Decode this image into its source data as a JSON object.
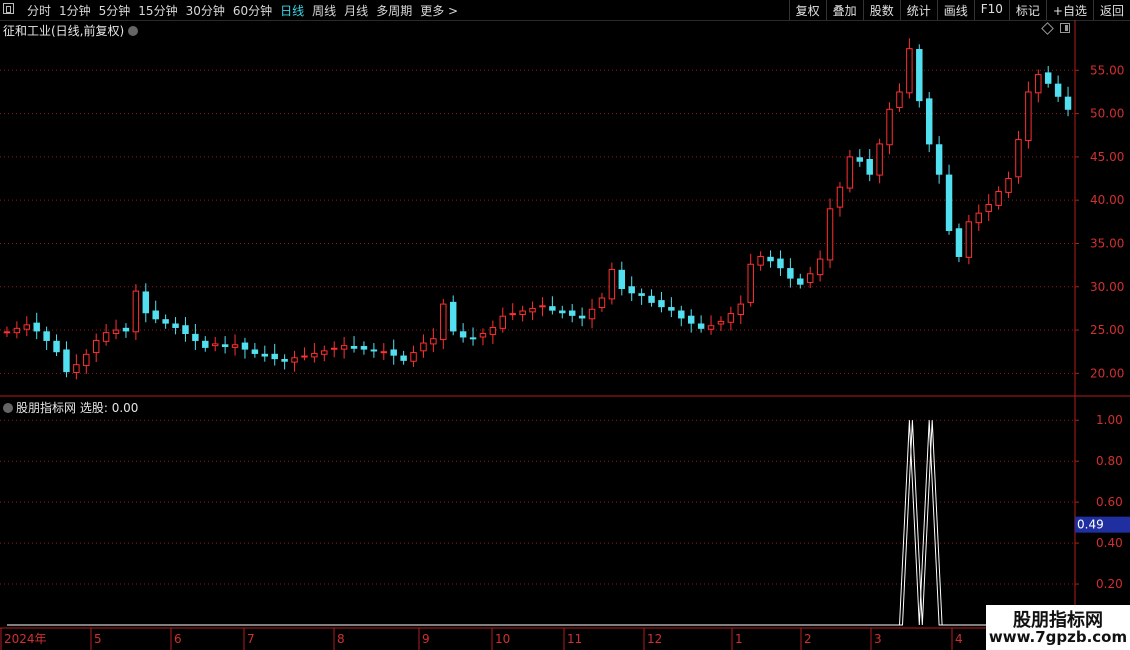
{
  "toolbar": {
    "periods": [
      "分时",
      "1分钟",
      "5分钟",
      "15分钟",
      "30分钟",
      "60分钟",
      "日线",
      "周线",
      "月线",
      "多周期",
      "更多 >"
    ],
    "active_period": "日线",
    "right_buttons": [
      "复权",
      "叠加",
      "股数",
      "统计",
      "画线",
      "F10",
      "标记",
      "+自选",
      "返回"
    ]
  },
  "main_chart": {
    "title": "征和工业(日线,前复权)",
    "y_ticks": [
      "55.00",
      "50.00",
      "45.00",
      "40.00",
      "35.00",
      "30.00",
      "25.00",
      "20.00"
    ]
  },
  "sub_chart": {
    "title": "股朋指标网",
    "indicator_label": "选股:",
    "indicator_value": "0.00",
    "y_ticks": [
      "1.00",
      "0.80",
      "0.60",
      "0.40",
      "0.20"
    ],
    "cursor_value": "0.49"
  },
  "x_axis": {
    "labels": [
      "2024年",
      "5",
      "6",
      "7",
      "8",
      "9",
      "10",
      "11",
      "12",
      "1",
      "2",
      "3",
      "4"
    ]
  },
  "watermark": {
    "line1": "股朋指标网",
    "line2": "www.7gpzb.com"
  },
  "colors": {
    "up": "#ff3030",
    "down": "#52e0f0",
    "grid": "#8a1a1a",
    "axis": "#b01e1e",
    "signal": "#ffffff",
    "cursor_bg": "#1f2fa0"
  },
  "chart_data": [
    {
      "type": "candlestick",
      "title": "征和工业(日线,前复权)",
      "ylim": [
        17.5,
        58.5
      ],
      "x_labels": [
        "2024年",
        "5",
        "6",
        "7",
        "8",
        "9",
        "10",
        "11",
        "12",
        "1",
        "2",
        "3",
        "4"
      ],
      "series": [
        {
          "name": "close",
          "values": [
            24.8,
            25.2,
            25.6,
            24.9,
            23.8,
            22.5,
            20.2,
            21.0,
            22.2,
            23.8,
            24.7,
            25.0,
            24.9,
            29.5,
            27.0,
            26.3,
            25.8,
            25.3,
            24.6,
            23.8,
            23.0,
            23.4,
            23.1,
            23.3,
            22.8,
            22.3,
            22.0,
            21.7,
            21.4,
            21.8,
            22.0,
            22.3,
            22.6,
            22.9,
            23.2,
            22.9,
            22.8,
            22.6,
            22.5,
            22.1,
            21.5,
            22.4,
            23.5,
            24.0,
            28.0,
            24.9,
            24.2,
            24.0,
            24.6,
            25.3,
            26.6,
            26.9,
            27.2,
            27.5,
            27.8,
            27.3,
            27.0,
            26.7,
            26.4,
            27.4,
            28.7,
            32.0,
            29.8,
            29.3,
            29.0,
            28.2,
            27.7,
            27.3,
            26.4,
            25.8,
            25.2,
            25.5,
            26.0,
            26.9,
            28.0,
            32.6,
            33.5,
            33.0,
            32.2,
            31.0,
            30.3,
            31.5,
            33.2,
            39.0,
            41.5,
            45.0,
            44.5,
            43.0,
            46.5,
            50.5,
            52.5,
            57.5,
            51.5,
            46.5,
            43.0,
            36.5,
            33.5,
            37.5,
            38.5,
            39.5,
            41.0,
            42.5,
            47.0,
            52.5,
            54.5,
            53.5,
            52.0,
            50.5
          ]
        }
      ]
    },
    {
      "type": "line",
      "title": "股朋指标网",
      "ylim": [
        0,
        1.05
      ],
      "series": [
        {
          "name": "选股",
          "values": [
            0,
            0,
            0,
            0,
            0,
            0,
            0,
            0,
            0,
            0,
            0,
            0,
            0,
            0,
            0,
            0,
            0,
            0,
            0,
            0,
            0,
            0,
            0,
            0,
            0,
            0,
            0,
            0,
            0,
            0,
            0,
            0,
            0,
            0,
            0,
            0,
            0,
            0,
            0,
            0,
            0,
            0,
            0,
            0,
            0,
            0,
            0,
            0,
            0,
            0,
            0,
            0,
            0,
            0,
            0,
            0,
            0,
            0,
            0,
            0,
            0,
            0,
            0,
            0,
            0,
            0,
            0,
            0,
            0,
            0,
            0,
            0,
            0,
            0,
            0,
            0,
            0,
            0,
            0,
            0,
            0,
            0,
            0,
            0,
            0,
            0,
            0,
            0,
            0,
            0,
            0,
            1,
            0,
            1,
            0,
            0,
            0,
            0,
            0,
            0,
            0,
            0,
            0,
            0,
            0,
            0,
            0,
            0
          ]
        }
      ]
    }
  ]
}
